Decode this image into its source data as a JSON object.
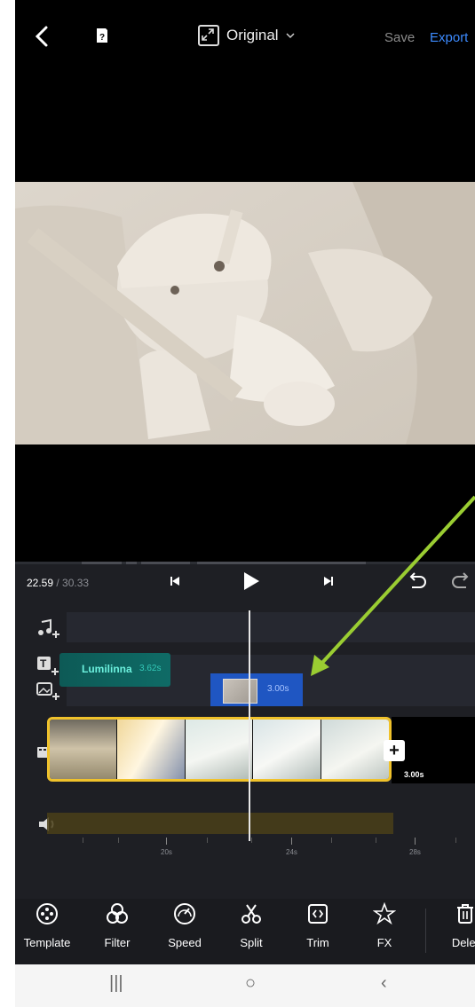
{
  "topbar": {
    "aspect_label": "Original",
    "save_label": "Save",
    "export_label": "Export"
  },
  "editor": {
    "current_time": "22.59",
    "total_time": " / 30.33",
    "tracks": {
      "text_clip": {
        "label": "Lumilinna",
        "duration": "3.62s"
      },
      "image_clip": {
        "duration": "3.00s"
      },
      "video_clip": {
        "duration": "3.00s"
      }
    },
    "ruler_labels": [
      "20s",
      "24s",
      "28s"
    ]
  },
  "tools": [
    {
      "label": "Template",
      "icon": "template-icon"
    },
    {
      "label": "Filter",
      "icon": "filter-icon"
    },
    {
      "label": "Speed",
      "icon": "speed-icon"
    },
    {
      "label": "Split",
      "icon": "scissors-icon"
    },
    {
      "label": "Trim",
      "icon": "trim-icon"
    },
    {
      "label": "FX",
      "icon": "fx-icon"
    },
    {
      "label": "Delet",
      "icon": "trash-icon"
    }
  ],
  "colors": {
    "accent": "#3d8bff",
    "text_track": "#0f6b66",
    "image_track": "#1f56c2",
    "selection": "#f0c22b",
    "annotation_arrow": "#9acd32"
  }
}
